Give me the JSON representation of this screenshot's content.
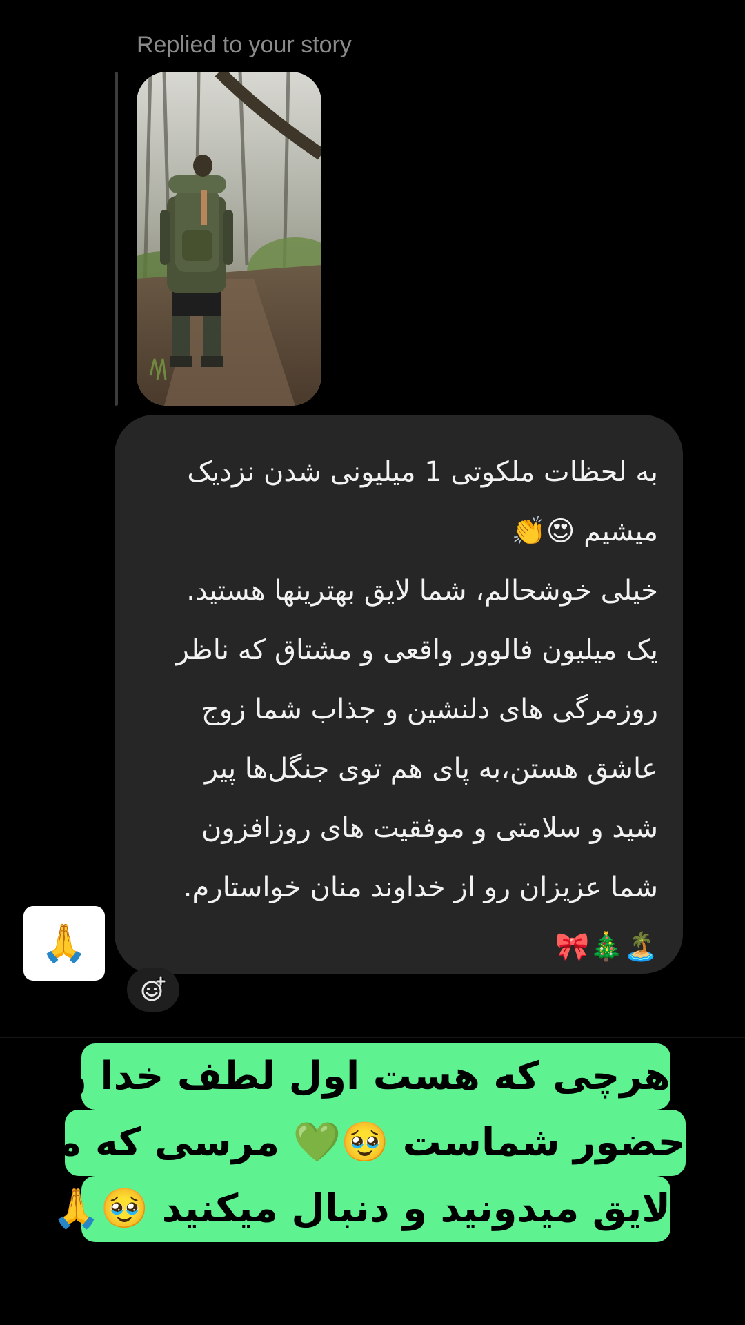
{
  "story_reply": {
    "label": "Replied to your story"
  },
  "message": {
    "text": "به لحظات ملکوتی 1 میلیونی شدن نزدیک\nمیشیم 😍👏\nخیلی خوشحالم، شما لایق بهترینها هستید.\nیک میلیون فالوور واقعی و مشتاق که ناظر\nروزمرگی های دلنشین و جذاب شما زوج\nعاشق هستن،به پای هم توی جنگل‌ها پیر\nشید و سلامتی و موفقیت های روزافزون\nشما عزیزان رو از خداوند منان خواستارم.\n🏝️🎄🎀"
  },
  "reaction": {
    "emoji": "🙏"
  },
  "caption": {
    "line1": "هرچی که هست اول لطف خدا و بعد",
    "line2": "حضور شماست 🥹💚 مرسی که ما رو",
    "line3": "لایق میدونید و دنبال میکنید 🥹🙏"
  },
  "colors": {
    "background": "#000000",
    "bubble": "#262626",
    "caption_highlight": "#5ff290"
  }
}
